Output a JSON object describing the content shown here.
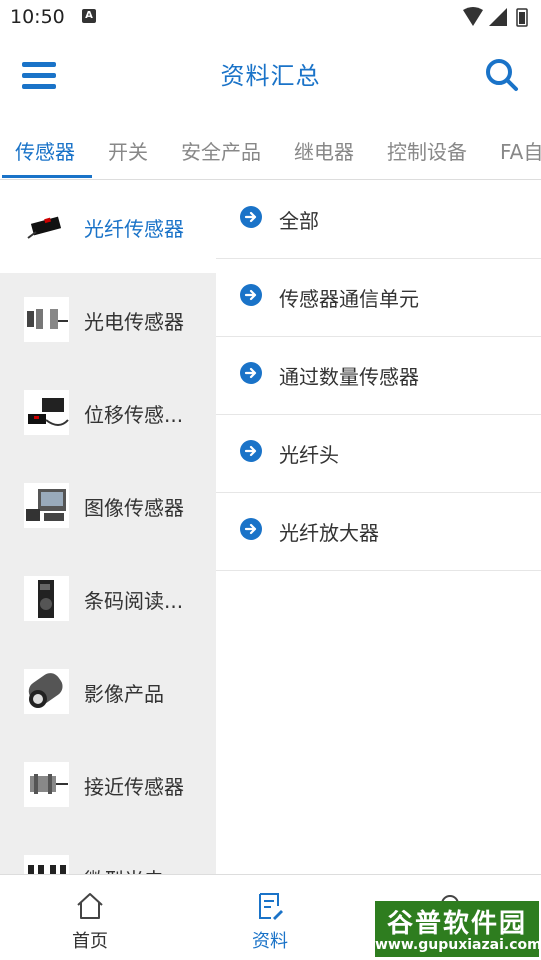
{
  "status_bar": {
    "time": "10:50",
    "notification_glyph": "A"
  },
  "app_bar": {
    "title": "资料汇总",
    "menu_icon": "hamburger-menu-icon",
    "search_icon": "search-icon"
  },
  "tabs": [
    {
      "label": "传感器",
      "active": true
    },
    {
      "label": "开关"
    },
    {
      "label": "安全产品"
    },
    {
      "label": "继电器"
    },
    {
      "label": "控制设备"
    },
    {
      "label": "FA自"
    }
  ],
  "sidebar": {
    "items": [
      {
        "label": "光纤传感器",
        "active": true
      },
      {
        "label": "光电传感器"
      },
      {
        "label": "位移传感..."
      },
      {
        "label": "图像传感器"
      },
      {
        "label": "条码阅读..."
      },
      {
        "label": "影像产品"
      },
      {
        "label": "接近传感器"
      },
      {
        "label": "微型光电"
      }
    ]
  },
  "content": {
    "items": [
      {
        "label": "全部"
      },
      {
        "label": "传感器通信单元"
      },
      {
        "label": "通过数量传感器"
      },
      {
        "label": "光纤头"
      },
      {
        "label": "光纤放大器"
      }
    ],
    "item_icon": "arrow-right-circle-icon"
  },
  "bottom_nav": {
    "items": [
      {
        "label": "首页",
        "icon": "home-icon"
      },
      {
        "label": "资料",
        "icon": "document-edit-icon",
        "active": true
      },
      {
        "label": "",
        "icon": "chat-icon"
      }
    ]
  },
  "watermark": {
    "title": "谷普软件园",
    "url": "www.gupuxiazai.com"
  },
  "colors": {
    "accent": "#1a73c8",
    "sidebar_bg": "#eeeeee",
    "watermark_bg": "#2e7d1f"
  }
}
